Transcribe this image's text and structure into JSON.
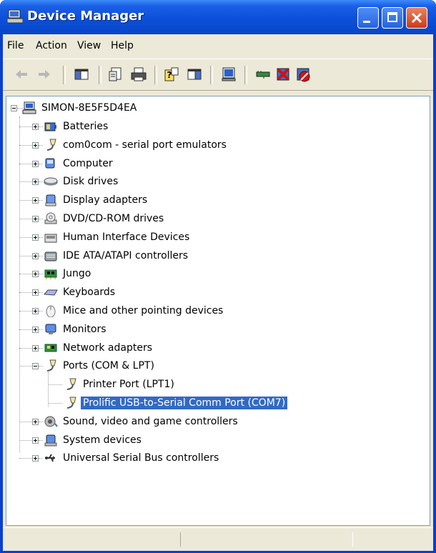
{
  "window": {
    "title": "Device Manager"
  },
  "menu": [
    "File",
    "Action",
    "View",
    "Help"
  ],
  "toolbar": {
    "icons": [
      "back-arrow-icon",
      "forward-arrow-icon",
      "show-hide-console-tree-icon",
      "properties-icon",
      "print-icon",
      "help-icon",
      "show-hide-action-pane-icon",
      "scan-hardware-icon",
      "update-driver-icon",
      "uninstall-icon",
      "disable-device-icon"
    ]
  },
  "tree": {
    "root": "SIMON-8E5F5D4EA",
    "categories": [
      {
        "label": "Batteries",
        "icon": "battery-icon",
        "expanded": false
      },
      {
        "label": "com0com - serial port emulators",
        "icon": "port-connector-icon",
        "expanded": false
      },
      {
        "label": "Computer",
        "icon": "computer-icon",
        "expanded": false
      },
      {
        "label": "Disk drives",
        "icon": "disk-drive-icon",
        "expanded": false
      },
      {
        "label": "Display adapters",
        "icon": "display-adapter-icon",
        "expanded": false
      },
      {
        "label": "DVD/CD-ROM drives",
        "icon": "dvd-drive-icon",
        "expanded": false
      },
      {
        "label": "Human Interface Devices",
        "icon": "hid-icon",
        "expanded": false
      },
      {
        "label": "IDE ATA/ATAPI controllers",
        "icon": "ide-controller-icon",
        "expanded": false
      },
      {
        "label": "Jungo",
        "icon": "circuit-board-icon",
        "expanded": false
      },
      {
        "label": "Keyboards",
        "icon": "keyboard-icon",
        "expanded": false
      },
      {
        "label": "Mice and other pointing devices",
        "icon": "mouse-icon",
        "expanded": false
      },
      {
        "label": "Monitors",
        "icon": "monitor-icon",
        "expanded": false
      },
      {
        "label": "Network adapters",
        "icon": "network-adapter-icon",
        "expanded": false
      },
      {
        "label": "Ports (COM & LPT)",
        "icon": "port-connector-icon",
        "expanded": true,
        "children": [
          {
            "label": "Printer Port (LPT1)",
            "icon": "port-connector-icon",
            "selected": false
          },
          {
            "label": "Prolific USB-to-Serial Comm Port (COM7)",
            "icon": "port-connector-icon",
            "selected": true
          }
        ]
      },
      {
        "label": "Sound, video and game controllers",
        "icon": "speaker-icon",
        "expanded": false
      },
      {
        "label": "System devices",
        "icon": "system-device-icon",
        "expanded": false
      },
      {
        "label": "Universal Serial Bus controllers",
        "icon": "usb-icon",
        "expanded": false
      }
    ]
  },
  "colors": {
    "titlebar": "#0a4fd8",
    "selection": "#316ac5",
    "chrome": "#ece9d8"
  }
}
